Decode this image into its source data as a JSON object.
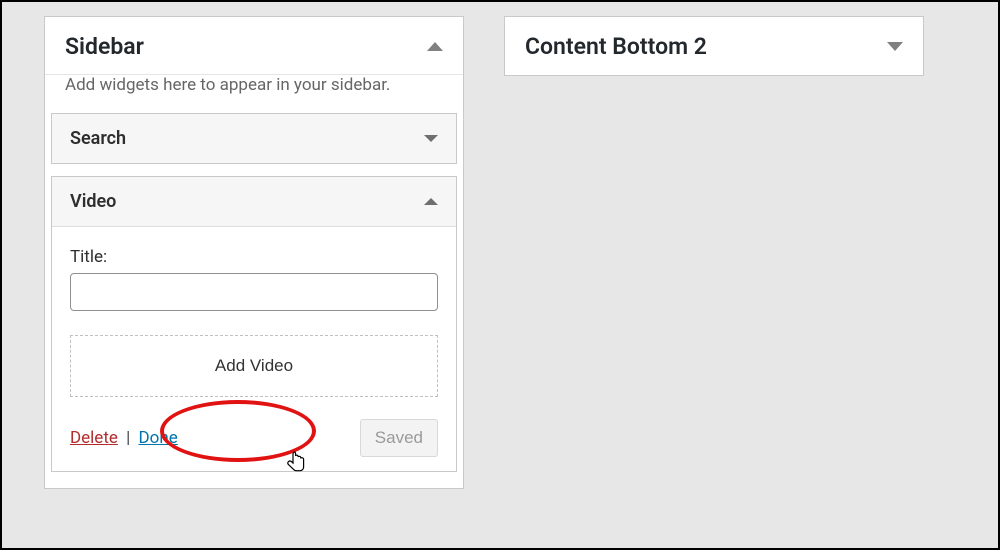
{
  "sidebar_area": {
    "title": "Sidebar",
    "description": "Add widgets here to appear in your sidebar.",
    "open": true,
    "widgets": {
      "search": {
        "title": "Search",
        "open": false
      },
      "video": {
        "title": "Video",
        "open": true,
        "title_field_label": "Title:",
        "title_field_value": "",
        "add_video_label": "Add Video",
        "delete_label": "Delete",
        "separator": "|",
        "done_label": "Done",
        "saved_label": "Saved"
      }
    }
  },
  "content_bottom_2": {
    "title": "Content Bottom 2",
    "open": false
  },
  "annotation": {
    "ellipse_target": "add-video-button"
  }
}
